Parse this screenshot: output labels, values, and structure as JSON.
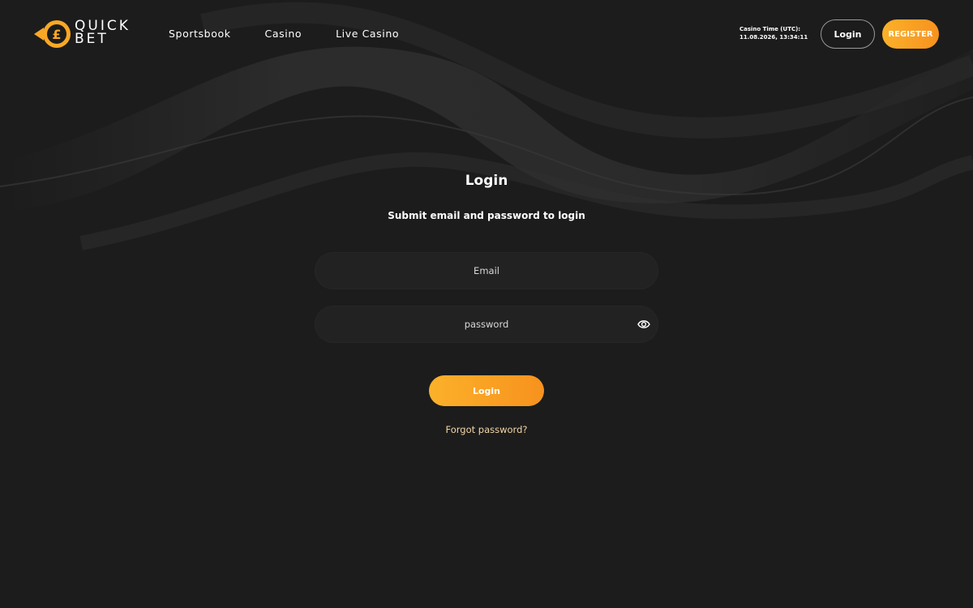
{
  "brand": {
    "logo_line1": "QUICK",
    "logo_line2": "BET",
    "accent_color": "#f9a825",
    "background_color": "#1c1c1c"
  },
  "nav": {
    "items": [
      {
        "label": "Sportsbook"
      },
      {
        "label": "Casino"
      },
      {
        "label": "Live Casino"
      }
    ]
  },
  "header": {
    "casino_time_label": "Casino Time (UTC):",
    "casino_time_value": "11.08.2026, 13:34:11",
    "login_label": "Login",
    "register_label": "REGISTER"
  },
  "login_form": {
    "title": "Login",
    "subtitle": "Submit email and password to login",
    "email_placeholder": "Email",
    "email_value": "",
    "password_placeholder": "password",
    "password_value": "",
    "password_toggle_icon": "eye-icon",
    "submit_label": "Login",
    "forgot_label": "Forgot password?"
  }
}
